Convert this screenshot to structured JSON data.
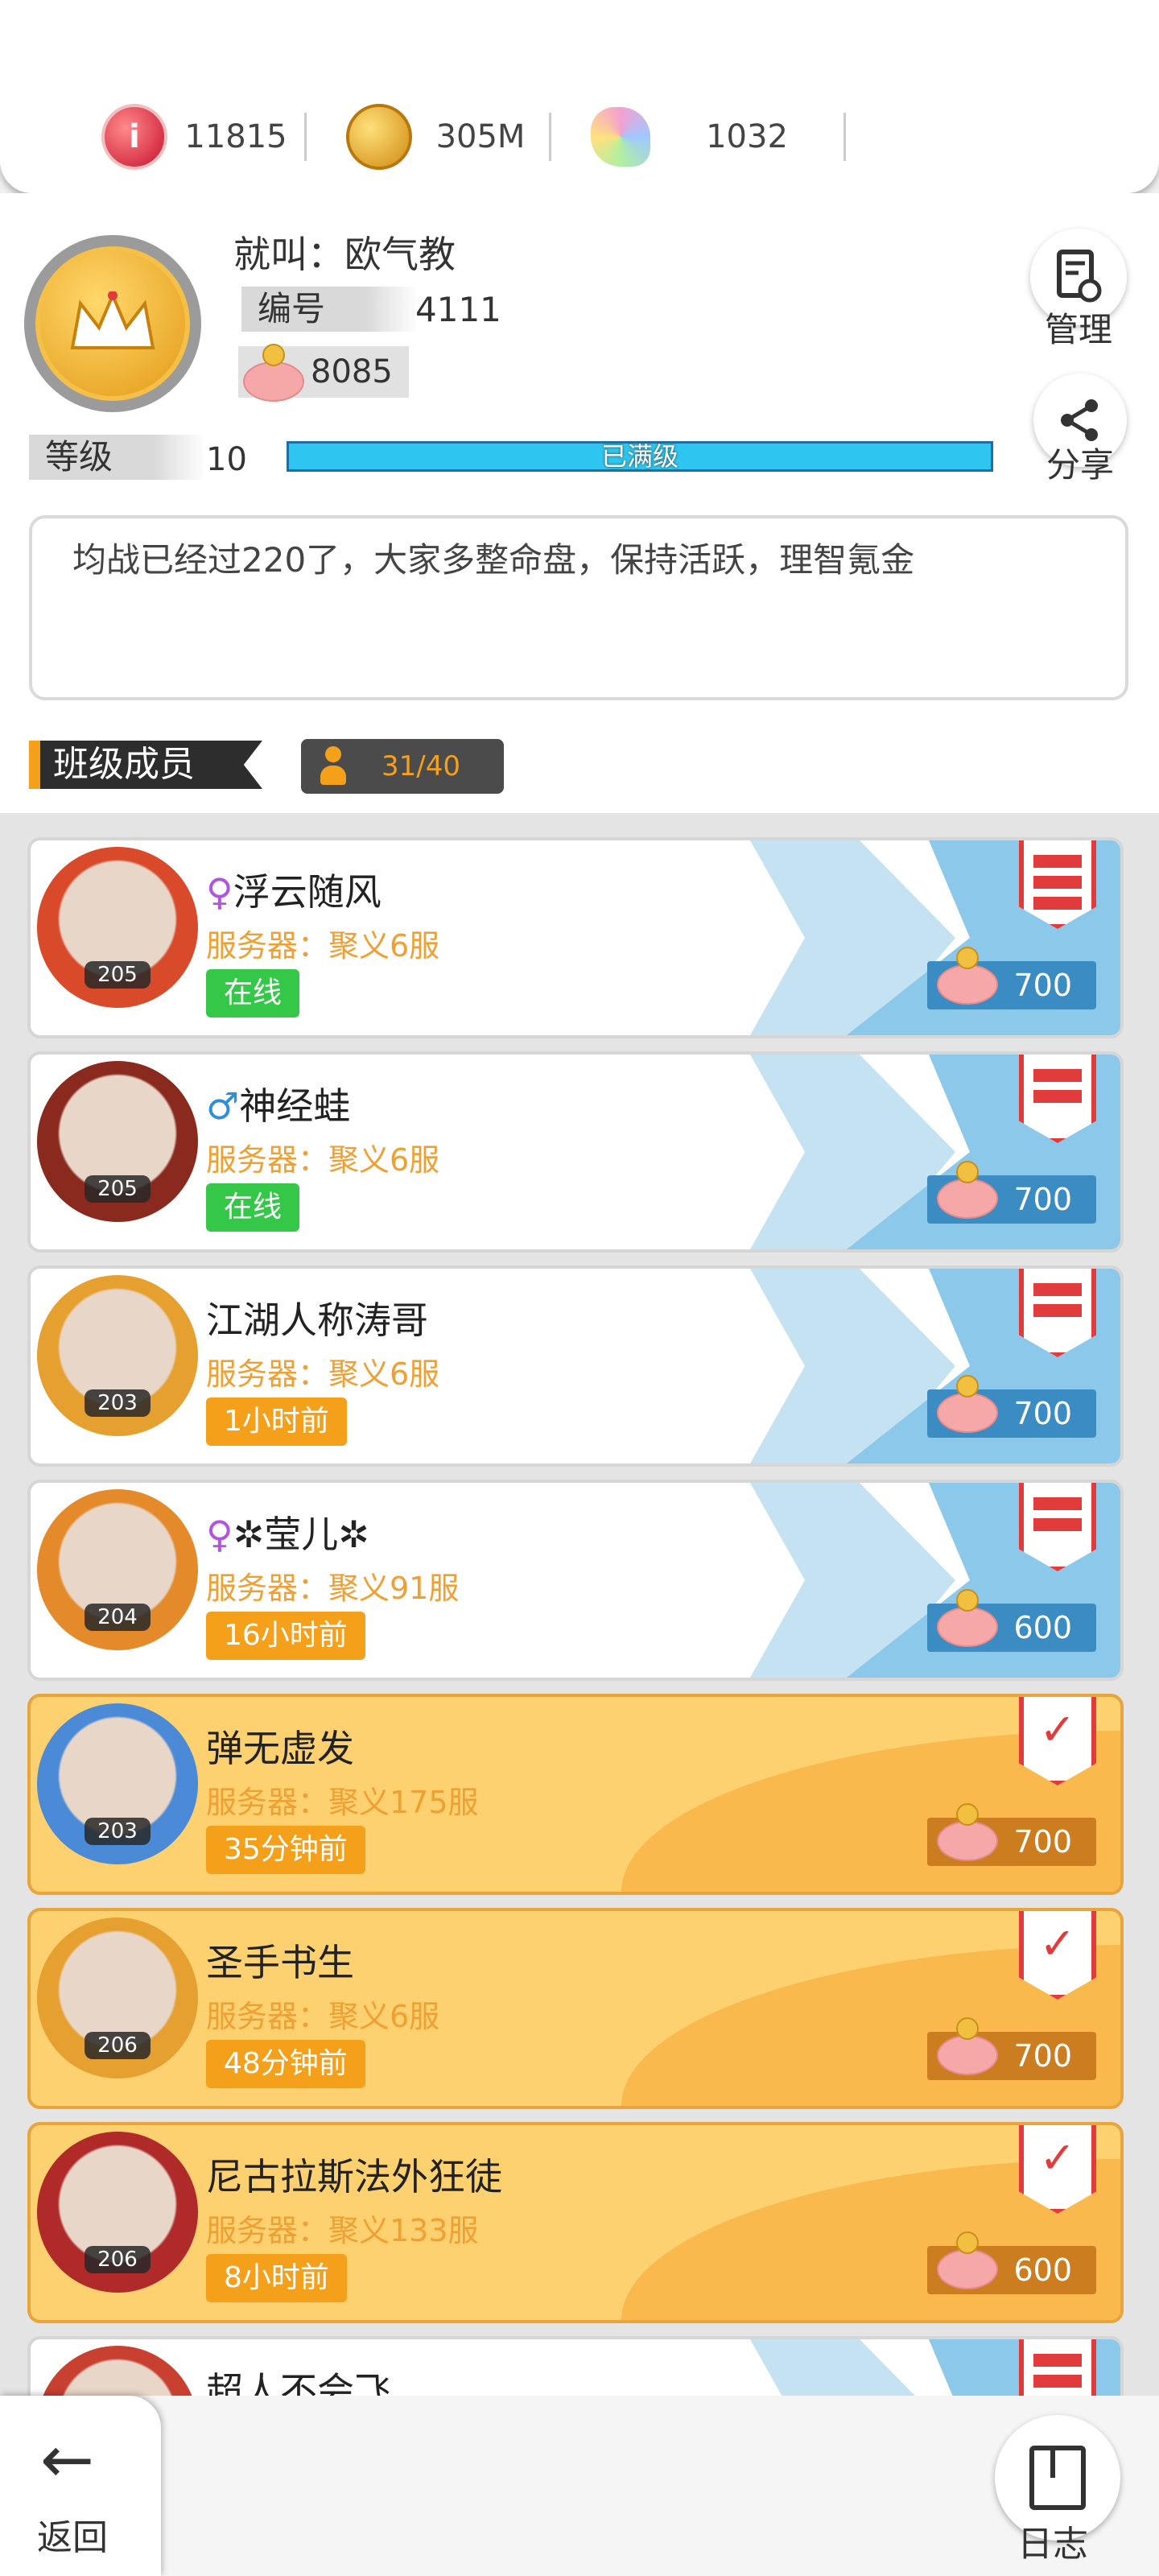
{
  "resources": [
    {
      "icon": "red-gem-icon",
      "value": "11815"
    },
    {
      "icon": "gold-coin-icon",
      "value": "305M"
    },
    {
      "icon": "rainbow-crystal-icon",
      "value": "1032"
    }
  ],
  "profile": {
    "name": "就叫：欧气教",
    "id_label": "编号",
    "id_value": "4111",
    "piggy_value": "8085",
    "level_label": "等级",
    "level_value": "10",
    "level_bar_text": "已满级",
    "level_progress": 1.0,
    "notice": "均战已经过220了，大家多整命盘，保持活跃，理智氪金"
  },
  "actions": {
    "manage_label": "管理",
    "share_label": "分享",
    "back_label": "返回",
    "log_label": "日志"
  },
  "members_section": {
    "title": "班级成员",
    "count": "31/40"
  },
  "members": [
    {
      "gender": "♀",
      "name": "浮云随风",
      "server": "服务器：聚义6服",
      "status": "在线",
      "online": true,
      "level": "205",
      "contribution": "700",
      "role": "leader",
      "style": "white",
      "avatar_color": "#d94a2a"
    },
    {
      "gender": "♂",
      "name": "神经蛙",
      "server": "服务器：聚义6服",
      "status": "在线",
      "online": true,
      "level": "205",
      "contribution": "700",
      "role": "officer",
      "style": "white",
      "avatar_color": "#8a2a1e"
    },
    {
      "gender": "",
      "name": "江湖人称涛哥",
      "server": "服务器：聚义6服",
      "status": "1小时前",
      "online": false,
      "level": "203",
      "contribution": "700",
      "role": "officer",
      "style": "white",
      "avatar_color": "#e6a030"
    },
    {
      "gender": "♀",
      "name": "✲莹儿✲",
      "server": "服务器：聚义91服",
      "status": "16小时前",
      "online": false,
      "level": "204",
      "contribution": "600",
      "role": "officer",
      "style": "white",
      "avatar_color": "#e58a2a"
    },
    {
      "gender": "",
      "name": "弹无虚发",
      "server": "服务器：聚义175服",
      "status": "35分钟前",
      "online": false,
      "level": "203",
      "contribution": "700",
      "role": "member",
      "style": "gold",
      "avatar_color": "#4a8ad6"
    },
    {
      "gender": "",
      "name": "圣手书生",
      "server": "服务器：聚义6服",
      "status": "48分钟前",
      "online": false,
      "level": "206",
      "contribution": "700",
      "role": "member",
      "style": "gold",
      "avatar_color": "#e6a030"
    },
    {
      "gender": "",
      "name": "尼古拉斯法外狂徒",
      "server": "服务器：聚义133服",
      "status": "8小时前",
      "online": false,
      "level": "206",
      "contribution": "600",
      "role": "member",
      "style": "gold",
      "avatar_color": "#b02a2a"
    },
    {
      "gender": "",
      "name": "超人不会飞",
      "server": "",
      "status": "",
      "online": false,
      "level": "",
      "contribution": "",
      "role": "officer",
      "style": "white",
      "avatar_color": "#c84030"
    }
  ]
}
